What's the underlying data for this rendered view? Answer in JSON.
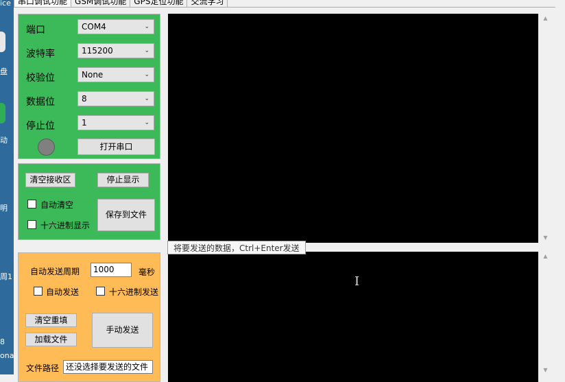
{
  "desktop": {
    "labels": [
      "ice",
      "盘",
      "动",
      "明",
      "周1",
      "8",
      "ona"
    ]
  },
  "tabs": [
    {
      "label": "串口调试功能",
      "active": true
    },
    {
      "label": "GSM调试功能",
      "active": false
    },
    {
      "label": "GPS定位功能",
      "active": false
    },
    {
      "label": "交流学习",
      "active": false
    }
  ],
  "serial": {
    "port_label": "端口",
    "port_value": "COM4",
    "baud_label": "波特率",
    "baud_value": "115200",
    "parity_label": "校验位",
    "parity_value": "None",
    "databits_label": "数据位",
    "databits_value": "8",
    "stopbits_label": "停止位",
    "stopbits_value": "1",
    "open_button": "打开串口",
    "status_color": "#808080"
  },
  "receive": {
    "clear_button": "清空接收区",
    "stop_button": "停止显示",
    "auto_clear_label": "自动清空",
    "hex_display_label": "十六进制显示",
    "save_button": "保存到文件"
  },
  "send": {
    "period_label": "自动发送周期",
    "period_value": "1000",
    "period_unit": "毫秒",
    "auto_send_label": "自动发送",
    "hex_send_label": "十六进制发送",
    "clear_button": "清空重填",
    "load_button": "加载文件",
    "manual_button": "手动发送",
    "path_label": "文件路径",
    "path_value": "还没选择要发送的文件",
    "tooltip": "将要发送的数据，Ctrl+Enter发送"
  },
  "colors": {
    "serial_panel": "#3cba5a",
    "send_panel": "#ffbc56",
    "terminal": "#000000"
  }
}
